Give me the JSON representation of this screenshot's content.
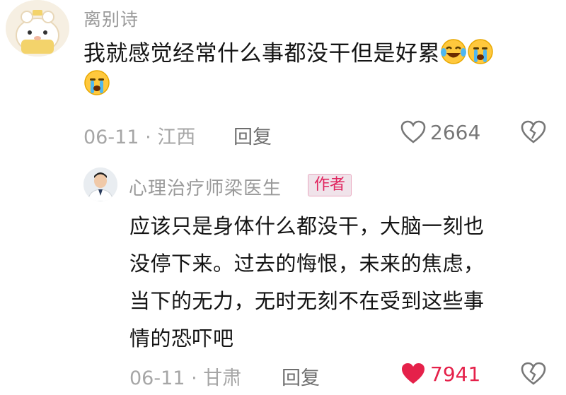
{
  "comment": {
    "username": "离别诗",
    "text": "我就感觉经常什么事都没干但是好累",
    "date": "06-11",
    "location": "江西",
    "reply_label": "回复",
    "likes": "2664"
  },
  "reply": {
    "username": "心理治疗师梁医生",
    "badge": "作者",
    "text_lines": [
      "应该只是身体什么都没干，大脑一刻也",
      "没停下来。过去的悔恨，未来的焦虑，",
      "当下的无力，无时无刻不在受到这些事",
      "情的恐吓吧"
    ],
    "date": "06-11",
    "location": "甘肃",
    "reply_label": "回复",
    "likes": "7941"
  },
  "colors": {
    "liked": "#e5214a",
    "meta": "#a6a6a6",
    "badge_text": "#e0245e"
  },
  "icons": [
    "laughing-crying-emoji",
    "crying-emoji",
    "heart-icon",
    "broken-heart-icon"
  ]
}
